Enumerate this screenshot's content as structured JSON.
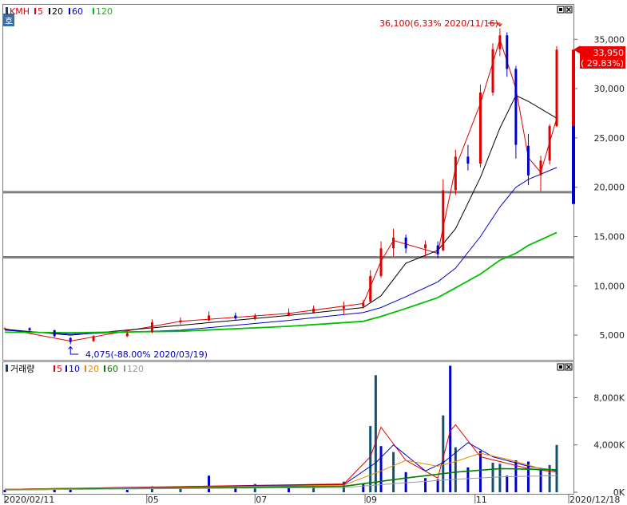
{
  "chart_data": [
    {
      "type": "candlestick",
      "panel": "price",
      "header": {
        "symbol": "KMH",
        "ma_legend": [
          {
            "label": "5",
            "color": "#e00000"
          },
          {
            "label": "20",
            "color": "#000000"
          },
          {
            "label": "60",
            "color": "#0000c8"
          },
          {
            "label": "120",
            "color": "#00c000"
          }
        ]
      },
      "y_ticks": [
        "35,000",
        "30,000",
        "25,000",
        "20,000",
        "15,000",
        "10,000",
        "5,000"
      ],
      "y_tick_values": [
        35000,
        30000,
        25000,
        20000,
        15000,
        10000,
        5000
      ],
      "ylim": [
        2500,
        38500
      ],
      "x_labels": [
        "2020/02/11",
        "05",
        "07",
        "09",
        "11",
        "2020/12/18"
      ],
      "x_label_dates": [
        "2020/02/11",
        "2020/05/01",
        "2020/07/01",
        "2020/09/01",
        "2020/11/02",
        "2020/12/18"
      ],
      "annotations": {
        "high_text": "36,100(6.33% 2020/11/16)",
        "high": {
          "date": "2020/11/16",
          "value": 36100
        },
        "low_text": "4,075(-88.00% 2020/03/19)",
        "low": {
          "date": "2020/03/19",
          "value": 4075
        },
        "last_price": "33,950",
        "last_change": "( 29.83%)"
      },
      "horizontal_lines": [
        19500,
        12900
      ],
      "side_letter": "호",
      "ohlc": [
        {
          "date": "2020/02/11",
          "o": 5650,
          "h": 5800,
          "l": 5550,
          "c": 5700
        },
        {
          "date": "2020/02/25",
          "o": 5700,
          "h": 5800,
          "l": 5400,
          "c": 5500
        },
        {
          "date": "2020/03/10",
          "o": 5500,
          "h": 5550,
          "l": 4800,
          "c": 4900
        },
        {
          "date": "2020/03/19",
          "o": 4700,
          "h": 4800,
          "l": 4075,
          "c": 4300
        },
        {
          "date": "2020/04/01",
          "o": 4400,
          "h": 5000,
          "l": 4300,
          "c": 4900
        },
        {
          "date": "2020/04/20",
          "o": 4900,
          "h": 5400,
          "l": 4800,
          "c": 5200
        },
        {
          "date": "2020/05/04",
          "o": 5300,
          "h": 6600,
          "l": 5200,
          "c": 6300
        },
        {
          "date": "2020/05/20",
          "o": 6300,
          "h": 6800,
          "l": 6100,
          "c": 6500
        },
        {
          "date": "2020/06/05",
          "o": 6500,
          "h": 7400,
          "l": 6400,
          "c": 7000
        },
        {
          "date": "2020/06/20",
          "o": 7000,
          "h": 7300,
          "l": 6500,
          "c": 6700
        },
        {
          "date": "2020/07/01",
          "o": 6700,
          "h": 7200,
          "l": 6500,
          "c": 7000
        },
        {
          "date": "2020/07/20",
          "o": 7000,
          "h": 7700,
          "l": 6900,
          "c": 7300
        },
        {
          "date": "2020/08/03",
          "o": 7300,
          "h": 8000,
          "l": 7200,
          "c": 7700
        },
        {
          "date": "2020/08/20",
          "o": 7700,
          "h": 8400,
          "l": 7100,
          "c": 7900
        },
        {
          "date": "2020/08/31",
          "o": 7900,
          "h": 8600,
          "l": 7700,
          "c": 8300
        },
        {
          "date": "2020/09/04",
          "o": 8400,
          "h": 11600,
          "l": 8300,
          "c": 11000
        },
        {
          "date": "2020/09/10",
          "o": 11000,
          "h": 14500,
          "l": 10800,
          "c": 13800
        },
        {
          "date": "2020/09/17",
          "o": 13800,
          "h": 15800,
          "l": 13000,
          "c": 14900
        },
        {
          "date": "2020/09/24",
          "o": 14900,
          "h": 15200,
          "l": 13300,
          "c": 13800
        },
        {
          "date": "2020/10/05",
          "o": 13800,
          "h": 14600,
          "l": 12900,
          "c": 14200
        },
        {
          "date": "2020/10/12",
          "o": 14100,
          "h": 14500,
          "l": 12800,
          "c": 13200
        },
        {
          "date": "2020/10/15",
          "o": 13600,
          "h": 20800,
          "l": 13500,
          "c": 19700
        },
        {
          "date": "2020/10/22",
          "o": 19700,
          "h": 23800,
          "l": 19200,
          "c": 23100
        },
        {
          "date": "2020/10/29",
          "o": 23100,
          "h": 24300,
          "l": 21700,
          "c": 22400
        },
        {
          "date": "2020/11/05",
          "o": 22400,
          "h": 30400,
          "l": 22000,
          "c": 29600
        },
        {
          "date": "2020/11/12",
          "o": 29600,
          "h": 34600,
          "l": 29300,
          "c": 34000
        },
        {
          "date": "2020/11/16",
          "o": 34000,
          "h": 36100,
          "l": 33300,
          "c": 35400
        },
        {
          "date": "2020/11/20",
          "o": 35400,
          "h": 35700,
          "l": 31200,
          "c": 32000
        },
        {
          "date": "2020/11/25",
          "o": 32000,
          "h": 32300,
          "l": 22900,
          "c": 24300
        },
        {
          "date": "2020/12/02",
          "o": 24200,
          "h": 25400,
          "l": 20200,
          "c": 21200
        },
        {
          "date": "2020/12/09",
          "o": 21200,
          "h": 23200,
          "l": 19600,
          "c": 22700
        },
        {
          "date": "2020/12/14",
          "o": 22700,
          "h": 26400,
          "l": 22300,
          "c": 26200
        },
        {
          "date": "2020/12/18",
          "o": 26200,
          "h": 34300,
          "l": 26100,
          "c": 33950
        }
      ],
      "ma": [
        {
          "name": "5",
          "color": "#e00000",
          "points": [
            [
              "2020/02/11",
              5650
            ],
            [
              "2020/03/19",
              4400
            ],
            [
              "2020/05/20",
              6400
            ],
            [
              "2020/07/20",
              7200
            ],
            [
              "2020/08/31",
              8200
            ],
            [
              "2020/09/10",
              12500
            ],
            [
              "2020/09/17",
              14600
            ],
            [
              "2020/10/12",
              13300
            ],
            [
              "2020/10/22",
              22000
            ],
            [
              "2020/11/05",
              28500
            ],
            [
              "2020/11/16",
              35000
            ],
            [
              "2020/11/25",
              30000
            ],
            [
              "2020/12/02",
              23000
            ],
            [
              "2020/12/09",
              21500
            ],
            [
              "2020/12/18",
              27000
            ]
          ]
        },
        {
          "name": "20",
          "color": "#000000",
          "points": [
            [
              "2020/02/11",
              5600
            ],
            [
              "2020/03/19",
              5000
            ],
            [
              "2020/05/20",
              6000
            ],
            [
              "2020/07/20",
              7000
            ],
            [
              "2020/08/31",
              7800
            ],
            [
              "2020/09/10",
              9000
            ],
            [
              "2020/09/24",
              12300
            ],
            [
              "2020/10/12",
              13600
            ],
            [
              "2020/10/22",
              15800
            ],
            [
              "2020/11/05",
              21000
            ],
            [
              "2020/11/16",
              26000
            ],
            [
              "2020/11/25",
              29300
            ],
            [
              "2020/12/02",
              28700
            ],
            [
              "2020/12/18",
              27000
            ]
          ]
        },
        {
          "name": "60",
          "color": "#0000c8",
          "points": [
            [
              "2020/02/11",
              5500
            ],
            [
              "2020/03/19",
              5100
            ],
            [
              "2020/05/20",
              5500
            ],
            [
              "2020/07/20",
              6500
            ],
            [
              "2020/08/31",
              7300
            ],
            [
              "2020/09/10",
              7800
            ],
            [
              "2020/09/24",
              8900
            ],
            [
              "2020/10/12",
              10400
            ],
            [
              "2020/10/22",
              11800
            ],
            [
              "2020/11/05",
              15000
            ],
            [
              "2020/11/16",
              18000
            ],
            [
              "2020/11/25",
              20000
            ],
            [
              "2020/12/02",
              20800
            ],
            [
              "2020/12/18",
              22000
            ]
          ]
        },
        {
          "name": "120",
          "color": "#00c000",
          "points": [
            [
              "2020/02/11",
              5300
            ],
            [
              "2020/03/19",
              5250
            ],
            [
              "2020/05/20",
              5400
            ],
            [
              "2020/07/20",
              5900
            ],
            [
              "2020/08/31",
              6400
            ],
            [
              "2020/09/10",
              6900
            ],
            [
              "2020/09/24",
              7700
            ],
            [
              "2020/10/12",
              8800
            ],
            [
              "2020/10/22",
              9800
            ],
            [
              "2020/11/05",
              11200
            ],
            [
              "2020/11/16",
              12600
            ],
            [
              "2020/11/25",
              13300
            ],
            [
              "2020/12/02",
              14100
            ],
            [
              "2020/12/18",
              15400
            ]
          ]
        }
      ]
    },
    {
      "type": "bar",
      "panel": "volume",
      "header": {
        "title": "거래량",
        "ma_legend": [
          {
            "label": "5",
            "color": "#e00000"
          },
          {
            "label": "10",
            "color": "#0000c8"
          },
          {
            "label": "20",
            "color": "#e88800"
          },
          {
            "label": "60",
            "color": "#008000"
          },
          {
            "label": "120",
            "color": "#999999"
          }
        ]
      },
      "y_ticks": [
        "8,000K",
        "4,000K",
        "0K"
      ],
      "y_tick_values": [
        8000,
        4000,
        0
      ],
      "ylim": [
        0,
        11000
      ],
      "unit": "K",
      "volume": [
        {
          "date": "2020/02/11",
          "v": 200
        },
        {
          "date": "2020/03/10",
          "v": 250
        },
        {
          "date": "2020/03/19",
          "v": 350
        },
        {
          "date": "2020/04/20",
          "v": 200
        },
        {
          "date": "2020/05/04",
          "v": 500
        },
        {
          "date": "2020/05/20",
          "v": 300
        },
        {
          "date": "2020/06/05",
          "v": 1400
        },
        {
          "date": "2020/06/20",
          "v": 500
        },
        {
          "date": "2020/07/01",
          "v": 700
        },
        {
          "date": "2020/07/20",
          "v": 600
        },
        {
          "date": "2020/08/03",
          "v": 500
        },
        {
          "date": "2020/08/20",
          "v": 900
        },
        {
          "date": "2020/08/31",
          "v": 700
        },
        {
          "date": "2020/09/04",
          "v": 5600
        },
        {
          "date": "2020/09/07",
          "v": 9900
        },
        {
          "date": "2020/09/10",
          "v": 3900
        },
        {
          "date": "2020/09/17",
          "v": 3400
        },
        {
          "date": "2020/09/24",
          "v": 1700
        },
        {
          "date": "2020/10/05",
          "v": 1200
        },
        {
          "date": "2020/10/12",
          "v": 1100
        },
        {
          "date": "2020/10/15",
          "v": 6500
        },
        {
          "date": "2020/10/19",
          "v": 10700
        },
        {
          "date": "2020/10/22",
          "v": 3800
        },
        {
          "date": "2020/10/29",
          "v": 2100
        },
        {
          "date": "2020/11/05",
          "v": 3500
        },
        {
          "date": "2020/11/12",
          "v": 2500
        },
        {
          "date": "2020/11/16",
          "v": 2400
        },
        {
          "date": "2020/11/20",
          "v": 1400
        },
        {
          "date": "2020/11/25",
          "v": 2700
        },
        {
          "date": "2020/12/02",
          "v": 2600
        },
        {
          "date": "2020/12/09",
          "v": 1900
        },
        {
          "date": "2020/12/14",
          "v": 2300
        },
        {
          "date": "2020/12/18",
          "v": 4000
        }
      ],
      "ma": [
        {
          "name": "5",
          "color": "#e00000",
          "points": [
            [
              "2020/02/11",
              250
            ],
            [
              "2020/08/20",
              700
            ],
            [
              "2020/09/04",
              3000
            ],
            [
              "2020/09/10",
              5500
            ],
            [
              "2020/09/24",
              2700
            ],
            [
              "2020/10/12",
              1200
            ],
            [
              "2020/10/19",
              5200
            ],
            [
              "2020/10/22",
              5700
            ],
            [
              "2020/11/05",
              3000
            ],
            [
              "2020/11/16",
              2600
            ],
            [
              "2020/12/02",
              2000
            ],
            [
              "2020/12/18",
              1700
            ]
          ]
        },
        {
          "name": "10",
          "color": "#0000c8",
          "points": [
            [
              "2020/02/11",
              250
            ],
            [
              "2020/08/20",
              650
            ],
            [
              "2020/09/07",
              2500
            ],
            [
              "2020/09/17",
              4000
            ],
            [
              "2020/10/05",
              1800
            ],
            [
              "2020/10/15",
              2500
            ],
            [
              "2020/10/29",
              4200
            ],
            [
              "2020/11/12",
              3000
            ],
            [
              "2020/12/02",
              2200
            ],
            [
              "2020/12/18",
              1800
            ]
          ]
        },
        {
          "name": "20",
          "color": "#e88800",
          "points": [
            [
              "2020/02/11",
              250
            ],
            [
              "2020/08/20",
              600
            ],
            [
              "2020/09/10",
              1800
            ],
            [
              "2020/09/24",
              2700
            ],
            [
              "2020/10/12",
              2200
            ],
            [
              "2020/10/22",
              2600
            ],
            [
              "2020/11/05",
              3300
            ],
            [
              "2020/11/20",
              2800
            ],
            [
              "2020/12/09",
              2000
            ],
            [
              "2020/12/18",
              1900
            ]
          ]
        },
        {
          "name": "60",
          "color": "#008000",
          "points": [
            [
              "2020/02/11",
              200
            ],
            [
              "2020/08/20",
              500
            ],
            [
              "2020/09/24",
              1200
            ],
            [
              "2020/10/22",
              1700
            ],
            [
              "2020/11/16",
              2000
            ],
            [
              "2020/12/18",
              1900
            ]
          ]
        },
        {
          "name": "120",
          "color": "#999999",
          "points": [
            [
              "2020/02/11",
              200
            ],
            [
              "2020/08/20",
              400
            ],
            [
              "2020/09/24",
              800
            ],
            [
              "2020/10/22",
              1100
            ],
            [
              "2020/11/16",
              1300
            ],
            [
              "2020/12/18",
              1400
            ]
          ]
        }
      ]
    }
  ]
}
